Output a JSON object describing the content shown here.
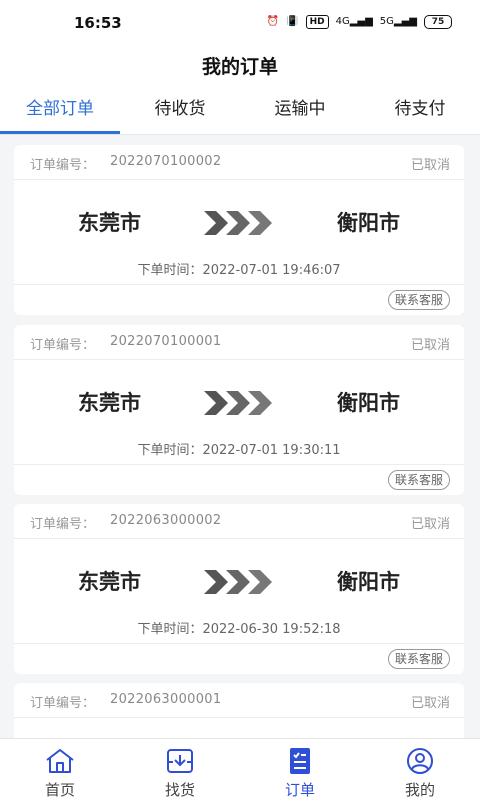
{
  "status_bar": {
    "time": "16:53",
    "hd_badge": "HD",
    "network": "4G",
    "wifi": "5G",
    "battery": "75"
  },
  "header": {
    "title": "我的订单"
  },
  "tabs": [
    {
      "label": "全部订单",
      "active": true
    },
    {
      "label": "待收货",
      "active": false
    },
    {
      "label": "运输中",
      "active": false
    },
    {
      "label": "待支付",
      "active": false
    }
  ],
  "order_number_label": "订单编号：",
  "order_time_label": "下单时间：",
  "orders": [
    {
      "number": "2022070100002",
      "status": "已取消",
      "from": "东莞市",
      "to": "衡阳市",
      "time": "2022-07-01 19:46:07",
      "contact": "联系客服"
    },
    {
      "number": "2022070100001",
      "status": "已取消",
      "from": "东莞市",
      "to": "衡阳市",
      "time": "2022-07-01 19:30:11",
      "contact": "联系客服"
    },
    {
      "number": "2022063000002",
      "status": "已取消",
      "from": "东莞市",
      "to": "衡阳市",
      "time": "2022-06-30 19:52:18",
      "contact": "联系客服"
    },
    {
      "number": "2022063000001",
      "status": "已取消"
    }
  ],
  "bottom_nav": [
    {
      "label": "首页",
      "icon": "home-icon",
      "active": false
    },
    {
      "label": "找货",
      "icon": "find-goods-icon",
      "active": false
    },
    {
      "label": "订单",
      "icon": "orders-icon",
      "active": true
    },
    {
      "label": "我的",
      "icon": "profile-icon",
      "active": false
    }
  ],
  "colors": {
    "accent": "#2f6fd6",
    "nav_active": "#2f4fd6",
    "arrow": "#555555"
  }
}
